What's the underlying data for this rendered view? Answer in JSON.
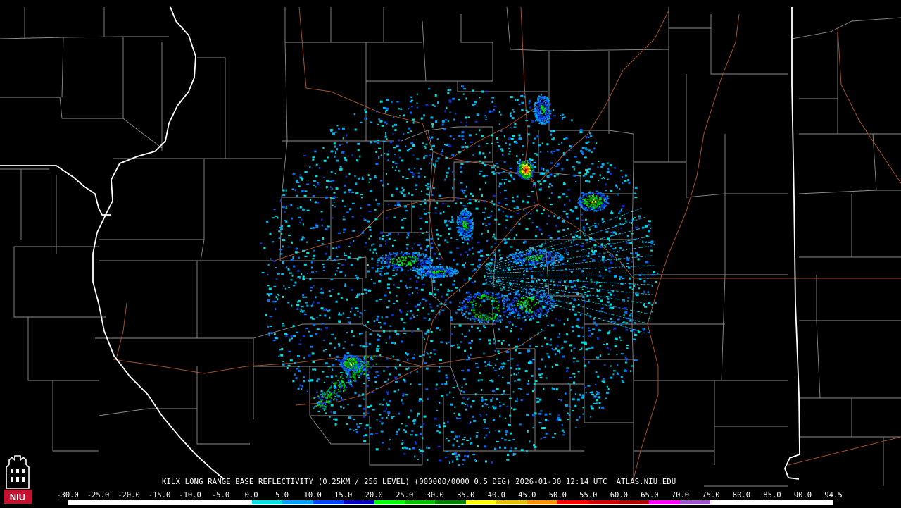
{
  "caption": "KILX LONG RANGE BASE REFLECTIVITY (0.25KM / 256 LEVEL) (000000/0000 0.5 DEG) 2026-01-30 12:14 UTC  ATLAS.NIU.EDU",
  "logo": {
    "text": "NIU",
    "icon": "university-tower-icon",
    "color": "#c8102e"
  },
  "scale": {
    "labels": [
      "-30.0",
      "-25.0",
      "-20.0",
      "-15.0",
      "-10.0",
      "-5.0",
      "0.0",
      "5.0",
      "10.0",
      "15.0",
      "20.0",
      "25.0",
      "30.0",
      "35.0",
      "40.0",
      "45.0",
      "50.0",
      "55.0",
      "60.0",
      "65.0",
      "70.0",
      "75.0",
      "80.0",
      "85.0",
      "90.0",
      "94.5"
    ],
    "colors": [
      "#ffffff",
      "#ffffff",
      "#ffffff",
      "#ffffff",
      "#ffffff",
      "#ffffff",
      "#00e0e0",
      "#009fff",
      "#0040ff",
      "#0000c0",
      "#00ff00",
      "#00c000",
      "#008000",
      "#ffff00",
      "#e0c000",
      "#ff9000",
      "#ff0000",
      "#d00000",
      "#b00000",
      "#ff00ff",
      "#9955c9",
      "#ffffff",
      "#ffffff",
      "#ffffff",
      "#ffffff"
    ]
  },
  "map_colors": {
    "background": "#000000",
    "county_lines": "#8c8c8c",
    "state_lines": "#ffffff",
    "roads": "#a0522d"
  },
  "chart_data": {
    "type": "heatmap",
    "title": "KILX LONG RANGE BASE REFLECTIVITY (0.25KM / 256 LEVEL) (000000/0000 0.5 DEG) 2026-01-30 12:14 UTC",
    "station": "KILX",
    "product": "LONG RANGE BASE REFLECTIVITY",
    "resolution": "0.25KM / 256 LEVEL",
    "elevation": "0.5 DEG",
    "datetime": "2026-01-30 12:14 UTC",
    "scale_min": -30.0,
    "scale_max": 94.5,
    "scale_step": 5.0,
    "echo_clusters": [
      {
        "max_dbz": 55,
        "spread": "compact"
      },
      {
        "max_dbz": 35,
        "spread": "compact"
      },
      {
        "max_dbz": 35,
        "spread": "compact"
      },
      {
        "max_dbz": 25,
        "spread": "elongated"
      },
      {
        "max_dbz": 20,
        "spread": "elongated"
      },
      {
        "max_dbz": 30,
        "spread": "ring"
      },
      {
        "max_dbz": 25,
        "spread": "elongated"
      },
      {
        "max_dbz": 20,
        "spread": "compact"
      },
      {
        "max_dbz": 20,
        "spread": "compact"
      },
      {
        "max_dbz": 20,
        "spread": "compact"
      }
    ]
  }
}
